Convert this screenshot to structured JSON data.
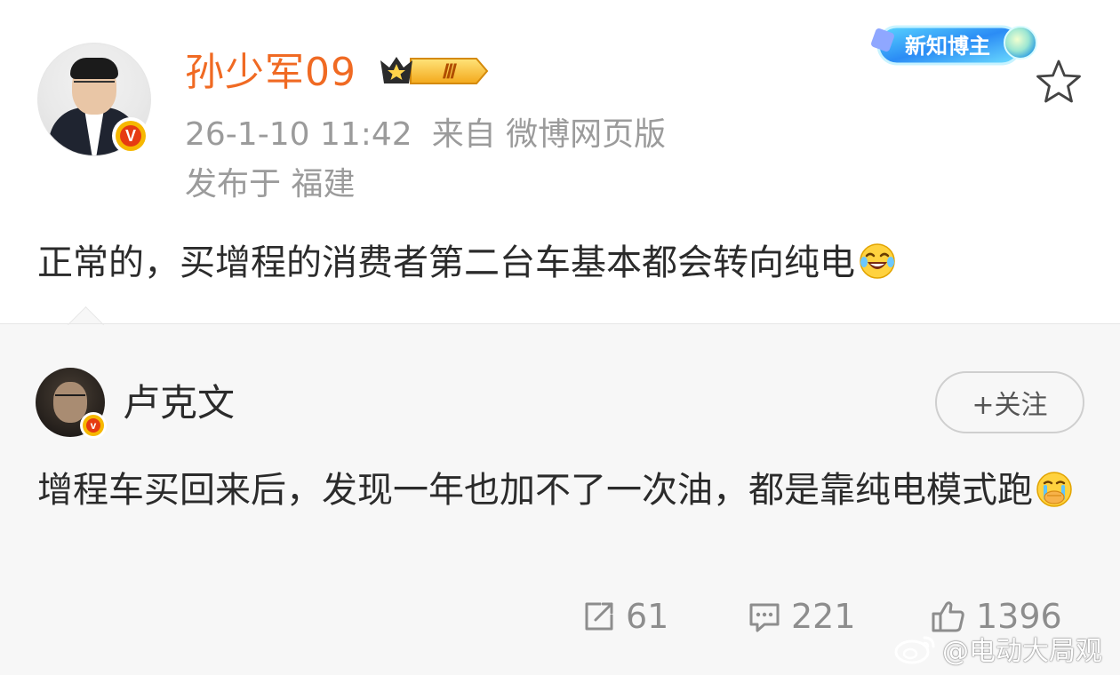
{
  "post": {
    "username": "孙少军09",
    "vip_level": "Ⅲ",
    "badge_label": "新知博主",
    "timestamp": "26-1-10 11:42",
    "source": "来自 微博网页版",
    "location": "发布于 福建",
    "text": "正常的，买增程的消费者第二台车基本都会转向纯电",
    "emoji": "laughing-crying-emoji",
    "verified_mark": "V"
  },
  "comment": {
    "username": "卢克文",
    "verified_mark": "v",
    "follow_label": "+关注",
    "text": "增程车买回来后，发现一年也加不了一次油，都是靠纯电模式跑",
    "emoji": "crying-covering-mouth-emoji"
  },
  "actions": {
    "repost_count": "61",
    "comment_count": "221",
    "like_count": "1396"
  },
  "watermark": {
    "text": "@电动大局观"
  },
  "colors": {
    "username": "#f06a23",
    "meta": "#9b9b9b",
    "text": "#2b2b2b",
    "card_bg": "#ffffff",
    "comment_bg": "#f7f7f7",
    "verified_gold": "#f6b800",
    "verified_red": "#e63b12"
  }
}
